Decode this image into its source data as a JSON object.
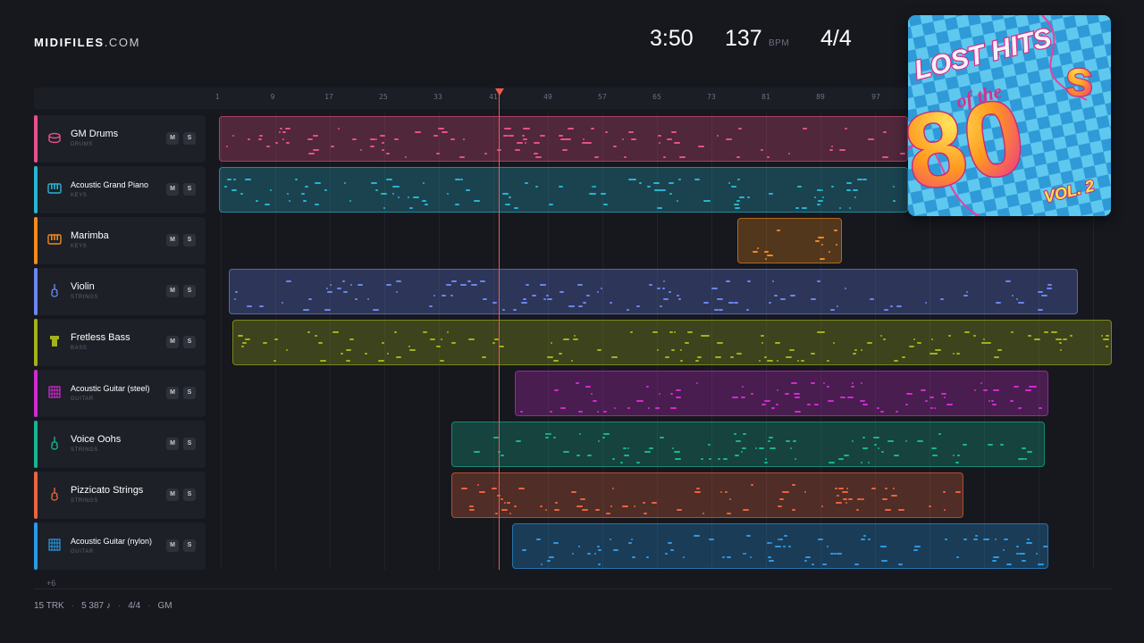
{
  "brand": {
    "name": "MIDIFILES",
    "suffix": ".COM"
  },
  "transport": {
    "time": "3:50",
    "bpm": "137",
    "bpm_label": "BPM",
    "time_signature": "4/4"
  },
  "ruler": {
    "bars": [
      "1",
      "9",
      "17",
      "25",
      "33",
      "41",
      "49",
      "57",
      "65",
      "73",
      "81",
      "89",
      "97"
    ]
  },
  "tracks": [
    {
      "name": "GM Drums",
      "category": "DRUMS",
      "color": "#e8508a",
      "icon": "drum-icon",
      "mute_label": "M",
      "solo_label": "S"
    },
    {
      "name": "Acoustic Grand Piano",
      "category": "KEYS",
      "color": "#28b4d2",
      "icon": "piano-icon",
      "mute_label": "M",
      "solo_label": "S"
    },
    {
      "name": "Marimba",
      "category": "KEYS",
      "color": "#f28a1e",
      "icon": "piano-icon",
      "mute_label": "M",
      "solo_label": "S"
    },
    {
      "name": "Violin",
      "category": "STRINGS",
      "color": "#6a86f0",
      "icon": "violin-icon",
      "mute_label": "M",
      "solo_label": "S"
    },
    {
      "name": "Fretless Bass",
      "category": "BASS",
      "color": "#a4b21a",
      "icon": "bass-icon",
      "mute_label": "M",
      "solo_label": "S"
    },
    {
      "name": "Acoustic Guitar (steel)",
      "category": "GUITAR",
      "color": "#d22ad2",
      "icon": "guitar-grid-icon",
      "mute_label": "M",
      "solo_label": "S"
    },
    {
      "name": "Voice Oohs",
      "category": "STRINGS",
      "color": "#1ab494",
      "icon": "violin-icon",
      "mute_label": "M",
      "solo_label": "S"
    },
    {
      "name": "Pizzicato Strings",
      "category": "STRINGS",
      "color": "#ea643e",
      "icon": "violin-icon",
      "mute_label": "M",
      "solo_label": "S"
    },
    {
      "name": "Acoustic Guitar (nylon)",
      "category": "GUITAR",
      "color": "#2a9ae8",
      "icon": "guitar-grid-icon",
      "mute_label": "M",
      "solo_label": "S"
    }
  ],
  "more_tracks": "+6",
  "footer": {
    "tracks": "15 TRK",
    "notes": "5 387 ♪",
    "time_signature": "4/4",
    "standard": "GM"
  },
  "album_cover": {
    "line1": "LOST HITS",
    "line2": "of the",
    "line3": "80",
    "line4": "s",
    "line5": "VOL. 2"
  },
  "colors": {
    "background": "#16181e",
    "playhead": "#ef5a4c"
  }
}
